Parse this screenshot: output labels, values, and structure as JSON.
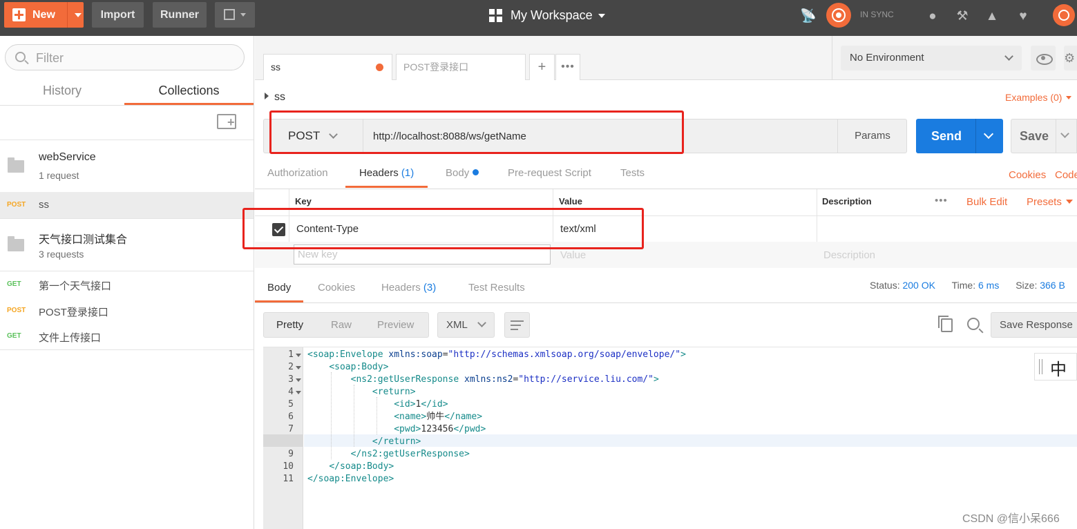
{
  "topbar": {
    "new_label": "New",
    "import_label": "Import",
    "runner_label": "Runner",
    "workspace_title": "My Workspace",
    "sync_status": "IN SYNC"
  },
  "sidebar": {
    "filter_placeholder": "Filter",
    "tabs": [
      "History",
      "Collections"
    ],
    "active_tab": "Collections",
    "collections": [
      {
        "name": "webService",
        "count": "1 request",
        "requests": [
          {
            "method": "POST",
            "name": "ss"
          }
        ]
      },
      {
        "name": "天气接口测试集合",
        "count": "3 requests",
        "requests": [
          {
            "method": "GET",
            "name": "第一个天气接口"
          },
          {
            "method": "POST",
            "name": "POST登录接口"
          },
          {
            "method": "GET",
            "name": "文件上传接口"
          }
        ]
      }
    ]
  },
  "request_tabs": [
    {
      "label": "ss",
      "unsaved": true
    },
    {
      "label": "POST登录接口"
    }
  ],
  "environment": {
    "selected": "No Environment"
  },
  "request": {
    "name": "ss",
    "examples_label": "Examples (0)",
    "method": "POST",
    "url": "http://localhost:8088/ws/getName",
    "params_label": "Params",
    "send_label": "Send",
    "save_label": "Save",
    "tabs": {
      "authorization": "Authorization",
      "headers": "Headers",
      "headers_count": "(1)",
      "body": "Body",
      "pre_request": "Pre-request Script",
      "tests": "Tests"
    },
    "cookies_label": "Cookies",
    "code_label": "Code",
    "headers_table": {
      "col_key": "Key",
      "col_value": "Value",
      "col_description": "Description",
      "bulk_edit": "Bulk Edit",
      "presets": "Presets",
      "rows": [
        {
          "enabled": true,
          "key": "Content-Type",
          "value": "text/xml"
        }
      ],
      "new_key_placeholder": "New key",
      "new_value_placeholder": "Value",
      "new_description_placeholder": "Description"
    }
  },
  "response": {
    "tabs": {
      "body": "Body",
      "cookies": "Cookies",
      "headers": "Headers",
      "headers_count": "(3)",
      "test_results": "Test Results"
    },
    "status_label": "Status:",
    "status_value": "200 OK",
    "time_label": "Time:",
    "time_value": "6 ms",
    "size_label": "Size:",
    "size_value": "366 B",
    "format_tabs": [
      "Pretty",
      "Raw",
      "Preview"
    ],
    "language": "XML",
    "save_response_label": "Save Response",
    "body_lines": [
      "<soap:Envelope xmlns:soap=\"http://schemas.xmlsoap.org/soap/envelope/\">",
      "    <soap:Body>",
      "        <ns2:getUserResponse xmlns:ns2=\"http://service.liu.com/\">",
      "            <return>",
      "                <id>1</id>",
      "                <name>帅牛</name>",
      "                <pwd>123456</pwd>",
      "            </return>",
      "        </ns2:getUserResponse>",
      "    </soap:Body>",
      "</soap:Envelope>"
    ]
  },
  "ime_char": "中",
  "watermark": "CSDN @信小呆666",
  "colors": {
    "accent": "#f26b3a",
    "send": "#1a7ce0",
    "annotation": "#e8231d"
  }
}
